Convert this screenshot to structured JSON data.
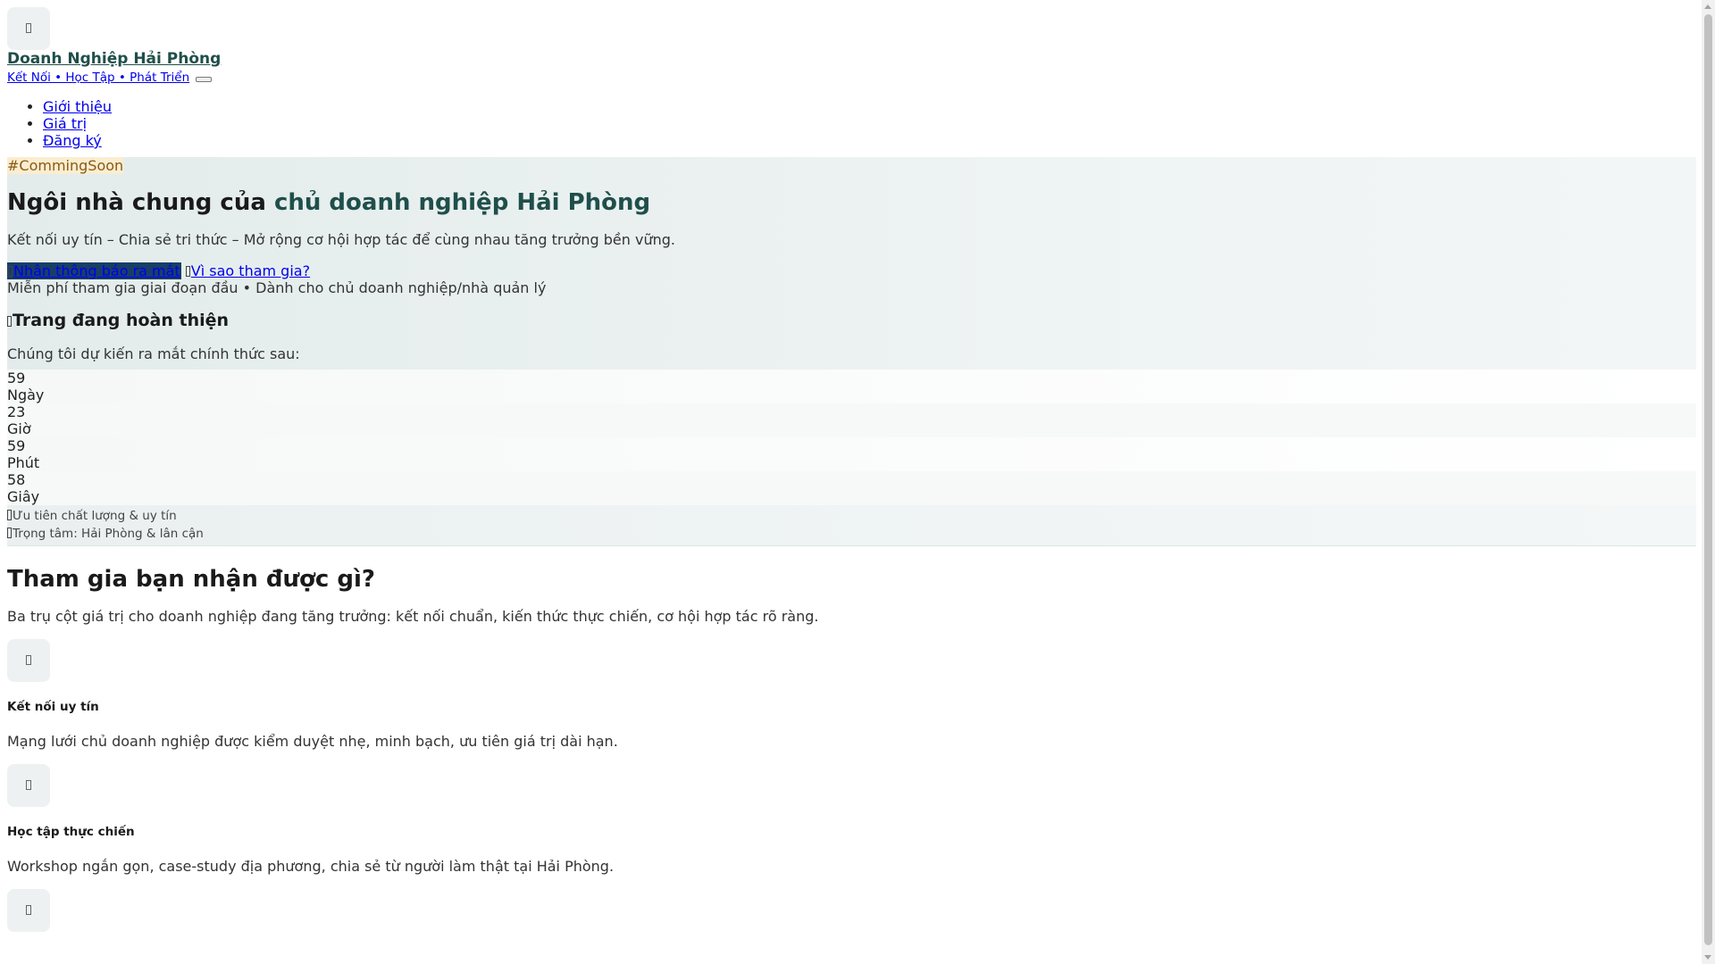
{
  "header": {
    "brand_title": "Doanh Nghiệp Hải Phòng",
    "brand_subtitle": "Kết Nối • Học Tập • Phát Triển",
    "nav": [
      {
        "label": "Giới thiệu"
      },
      {
        "label": "Giá trị"
      },
      {
        "label": "Đăng ký"
      }
    ]
  },
  "hero": {
    "tag": "#CommingSoon",
    "title_prefix": "Ngôi nhà chung của ",
    "title_accent": "chủ doanh nghiệp Hải Phòng",
    "lead": "Kết nối uy tín – Chia sẻ tri thức – Mở rộng cơ hội hợp tác để cùng nhau tăng trưởng bền vững.",
    "cta_primary": "Nhận thông báo ra mắt",
    "cta_secondary": "Vì sao tham gia?",
    "note": "Miễn phí tham gia giai đoạn đầu • Dành cho chủ doanh nghiệp/nhà quản lý",
    "status_title": "Trang đang hoàn thiện",
    "launch_text": "Chúng tôi dự kiến ra mắt chính thức sau:",
    "countdown": [
      {
        "value": "59",
        "label": "Ngày"
      },
      {
        "value": "23",
        "label": "Giờ"
      },
      {
        "value": "59",
        "label": "Phút"
      },
      {
        "value": "58",
        "label": "Giây"
      }
    ],
    "chips": [
      "Ưu tiên chất lượng & uy tín",
      "Trọng tâm: Hải Phòng & lân cận"
    ]
  },
  "benefits": {
    "title": "Tham gia bạn nhận được gì?",
    "subtitle": "Ba trụ cột giá trị cho doanh nghiệp đang tăng trưởng: kết nối chuẩn, kiến thức thực chiến, cơ hội hợp tác rõ ràng.",
    "cards": [
      {
        "title": "Kết nối uy tín",
        "text": "Mạng lưới chủ doanh nghiệp được kiểm duyệt nhẹ, minh bạch, ưu tiên giá trị dài hạn."
      },
      {
        "title": "Học tập thực chiến",
        "text": "Workshop ngắn gọn, case-study địa phương, chia sẻ từ người làm thật tại Hải Phòng."
      }
    ]
  },
  "colors": {
    "brand": "#1f4f4b",
    "tag_bg": "#fbedd0",
    "cta_bg": "#173f66",
    "link": "#0000ee"
  }
}
